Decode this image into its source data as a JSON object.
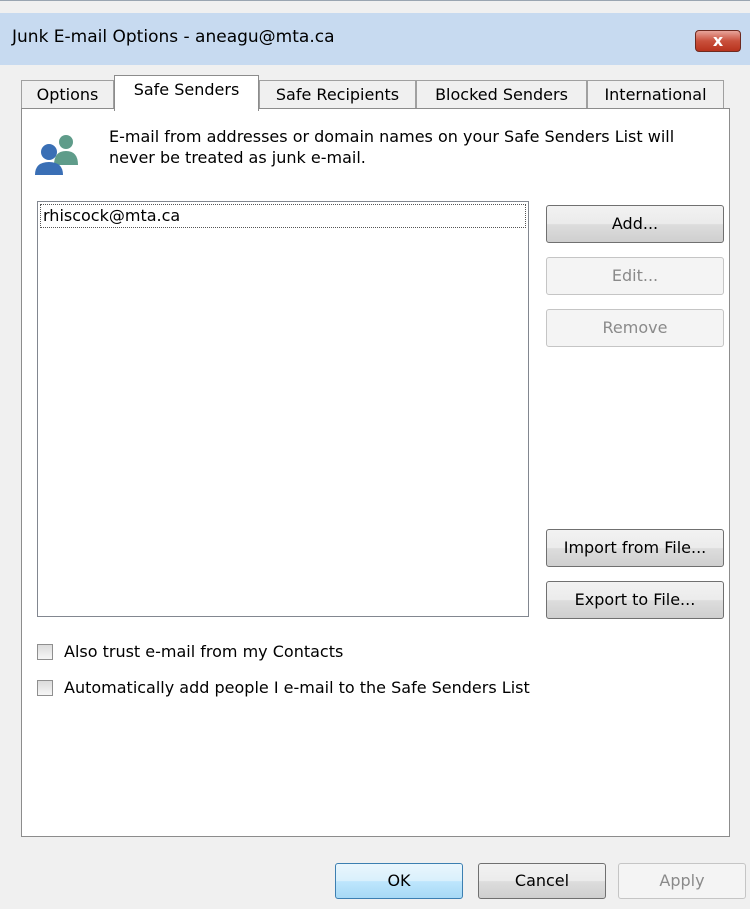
{
  "window": {
    "title": "Junk E-mail Options - aneagu@mta.ca",
    "close_label": "x"
  },
  "tabs": [
    {
      "label": "Options",
      "active": false
    },
    {
      "label": "Safe Senders",
      "active": true
    },
    {
      "label": "Safe Recipients",
      "active": false
    },
    {
      "label": "Blocked Senders",
      "active": false
    },
    {
      "label": "International",
      "active": false
    }
  ],
  "panel": {
    "icon": "people-icon",
    "description": "E-mail from addresses or domain names on your Safe Senders List will never be treated as junk e-mail.",
    "senders": [
      "rhiscock@mta.ca"
    ],
    "buttons": {
      "add": "Add...",
      "edit": "Edit...",
      "remove": "Remove",
      "import": "Import from File...",
      "export": "Export to File..."
    },
    "checkboxes": [
      {
        "label": "Also trust e-mail from my Contacts",
        "checked": false
      },
      {
        "label": "Automatically add people I e-mail to the Safe Senders List",
        "checked": false
      }
    ]
  },
  "footer": {
    "ok": "OK",
    "cancel": "Cancel",
    "apply": "Apply"
  },
  "colors": {
    "titlebar": "#c7daf0",
    "close_button": "#c9503c",
    "icon_front": "#3a6fb5",
    "icon_back": "#5f9c8a"
  }
}
